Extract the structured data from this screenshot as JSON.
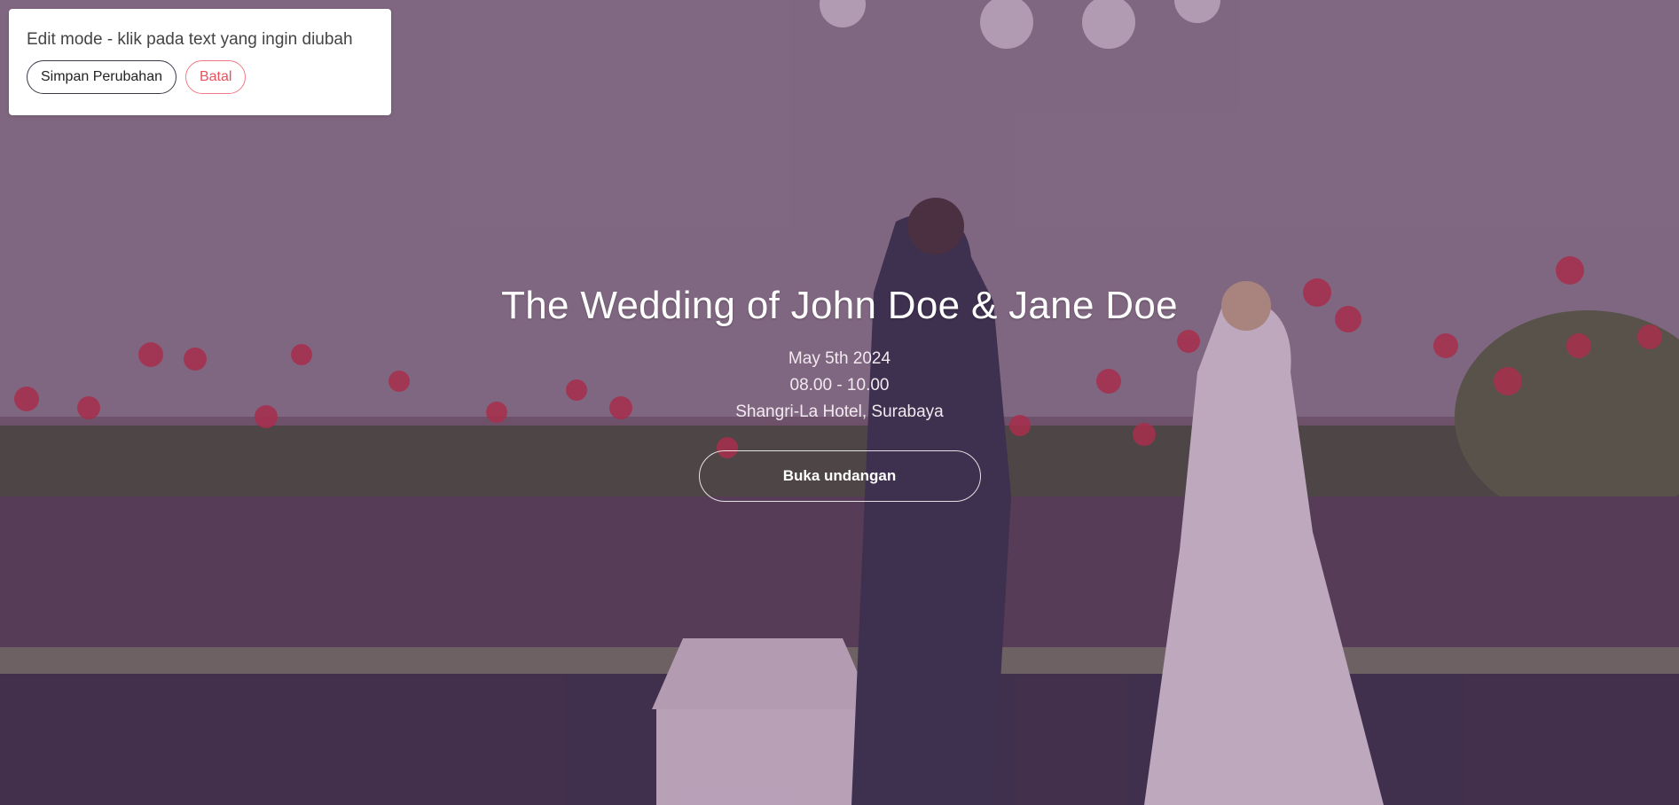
{
  "edit_bar": {
    "message": "Edit mode - klik pada text yang ingin diubah",
    "save_label": "Simpan Perubahan",
    "cancel_label": "Batal"
  },
  "hero": {
    "title": "The Wedding of John Doe & Jane Doe",
    "date": "May 5th 2024",
    "time": "08.00 - 10.00",
    "venue": "Shangri-La Hotel, Surabaya",
    "open_button_label": "Buka undangan",
    "overlay_color": "#6e3c6e"
  },
  "colors": {
    "cancel_accent": "#e8505c",
    "balloon_red": "#c8283c"
  }
}
